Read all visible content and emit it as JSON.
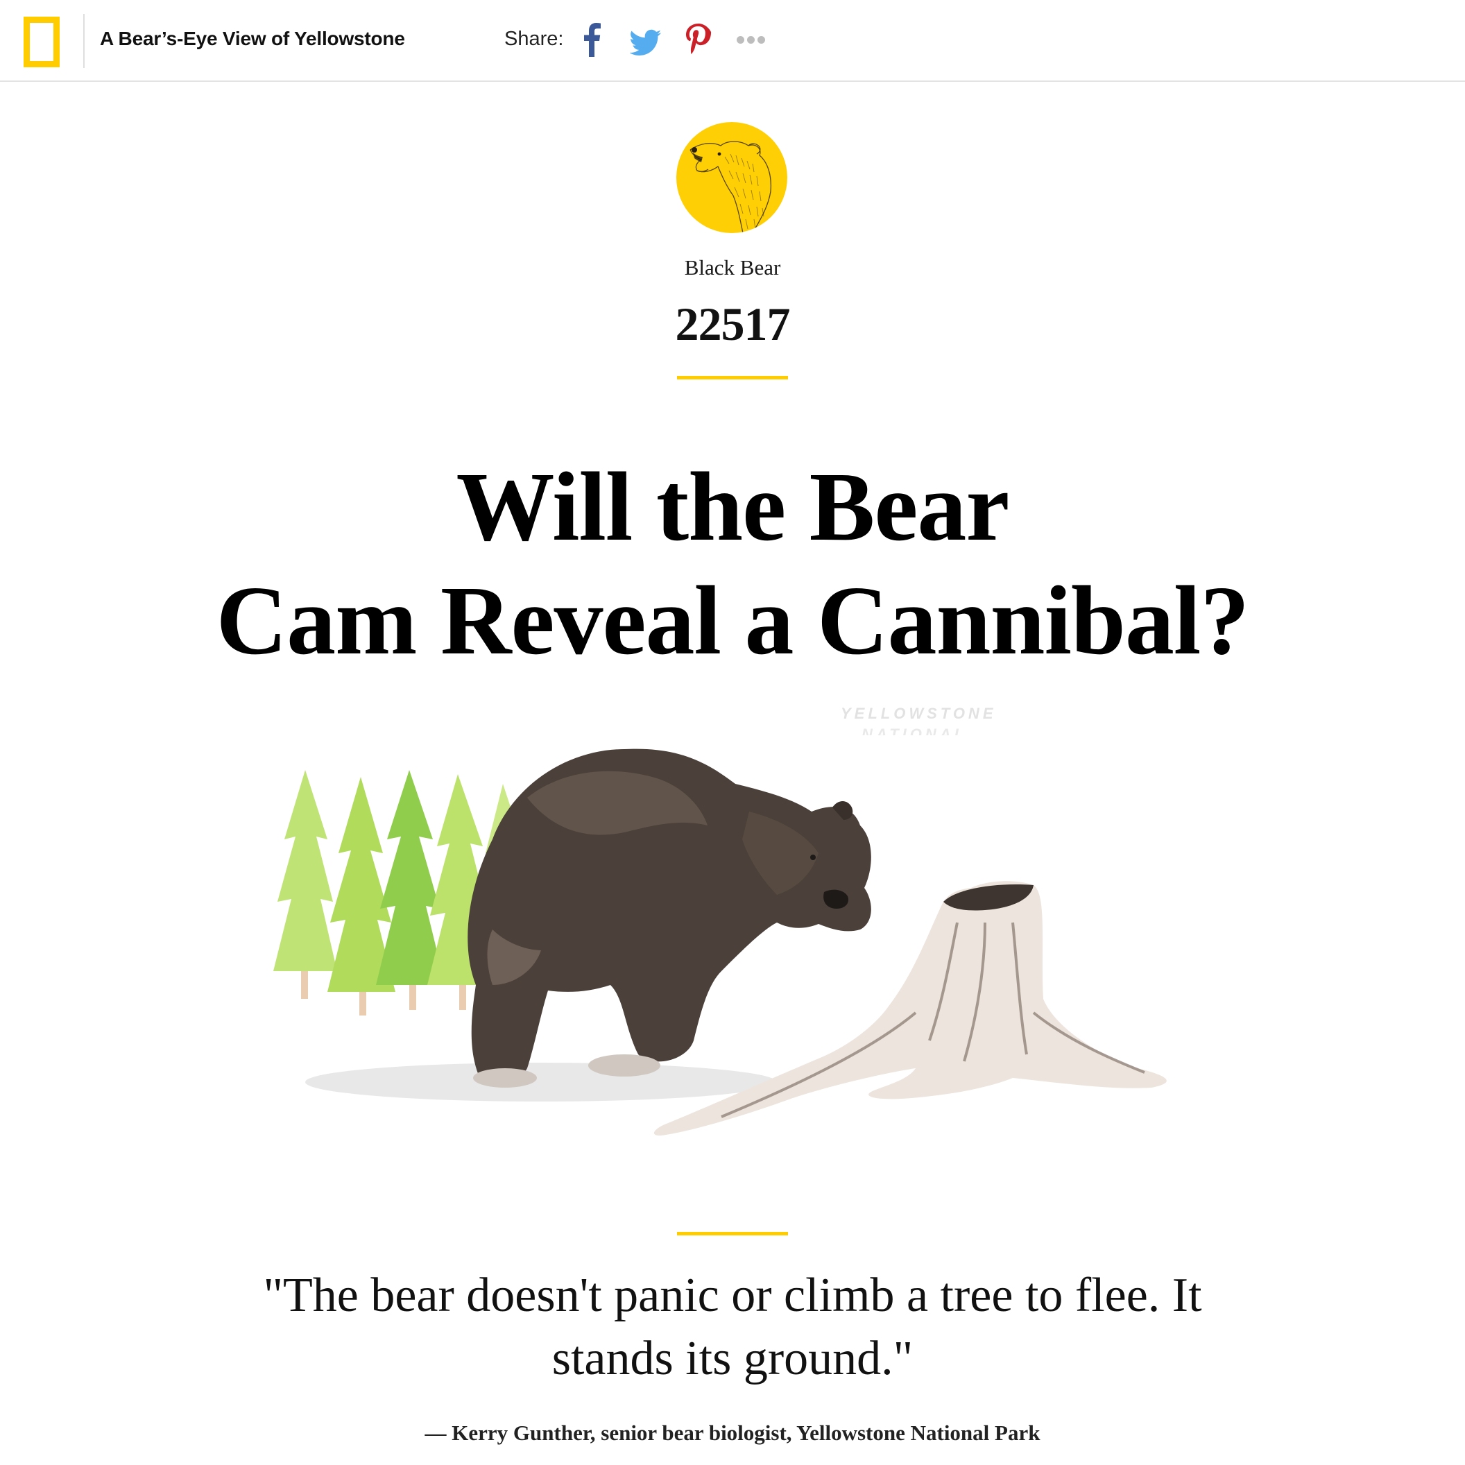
{
  "header": {
    "logo_icon": "national-geographic-yellow-border",
    "site_title": "A Bear’s-Eye View of Yellowstone",
    "share_label": "Share:",
    "share_buttons": [
      {
        "icon": "facebook-icon",
        "color": "#3b5998"
      },
      {
        "icon": "twitter-icon",
        "color": "#55acee"
      },
      {
        "icon": "pinterest-icon",
        "color": "#cb2027"
      },
      {
        "icon": "more-icon",
        "color": "#bdbdbd"
      }
    ]
  },
  "hero": {
    "badge_icon": "roaring-bear-icon",
    "badge_color": "#ffcf05",
    "category": "Black Bear",
    "bear_id": "22517",
    "accent_color": "#ffcc00",
    "headline_line1": "Will the Bear",
    "headline_line2": "Cam Reveal a Cannibal?",
    "watermark_line1": "YELLOWSTONE",
    "watermark_line2": "NATIONAL",
    "illustration": "watercolor-bear-by-tree-stump-with-pine-trees"
  },
  "quote": {
    "text": "\"The bear doesn't panic or climb a tree to flee. It stands its ground.\"",
    "attribution": "— Kerry Gunther, senior bear biologist, Yellowstone National Park"
  }
}
